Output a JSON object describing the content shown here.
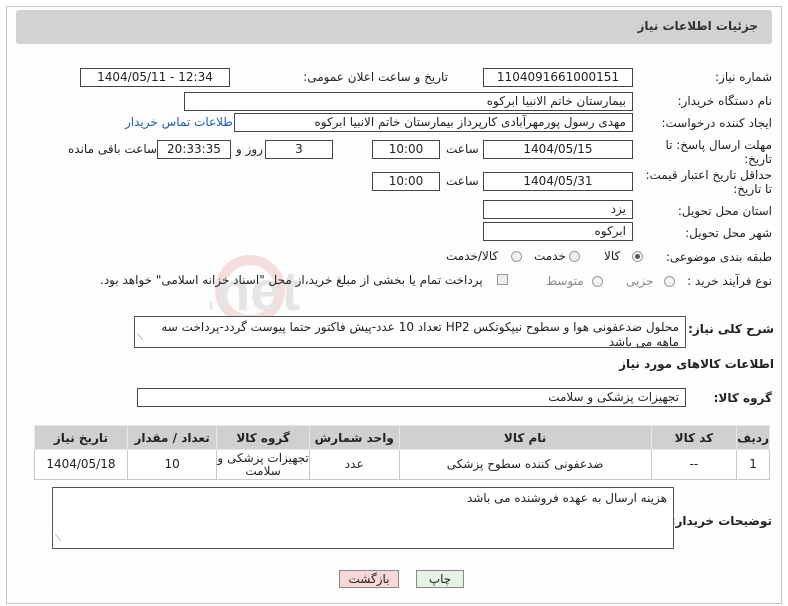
{
  "header": {
    "title": "جزئیات اطلاعات نیاز"
  },
  "fields": {
    "need_number_label": "شماره نیاز:",
    "need_number": "1104091661000151",
    "announce_label": "تاریخ و ساعت اعلان عمومی:",
    "announce_value": "1404/05/11 - 12:34",
    "buyer_org_label": "نام دستگاه خریدار:",
    "buyer_org": "بیمارستان خاتم الانبیا ابرکوه",
    "creator_label": "ایجاد کننده درخواست:",
    "creator": "مهدی رسول پورمهرآبادی کارپرداز بیمارستان خاتم الانبیا ابرکوه",
    "contact_link": "اطلاعات تماس خریدار",
    "deadline_label": "مهلت ارسال پاسخ: تا",
    "deadline_label2": "تاریخ:",
    "deadline_date": "1404/05/15",
    "time_label": "ساعت",
    "deadline_time": "10:00",
    "days_value": "3",
    "days_label": "روز و",
    "remaining_time": "20:33:35",
    "remaining_label": "ساعت باقی مانده",
    "validity_label": "حداقل تاریخ اعتبار قیمت:",
    "validity_label2": "تا تاریخ:",
    "validity_date": "1404/05/31",
    "validity_time": "10:00",
    "province_label": "استان محل تحویل:",
    "province": "یزد",
    "city_label": "شهر محل تحویل:",
    "city": "ابرکوه",
    "category_label": "طبقه بندی موضوعی:",
    "category_options": [
      "کالا",
      "خدمت",
      "کالا/خدمت"
    ],
    "process_label": "نوع فرآیند خرید :",
    "process_options": [
      "جزیی",
      "متوسط"
    ],
    "payment_note": "پرداخت تمام یا بخشی از مبلغ خرید،از محل \"اسناد خزانه اسلامی\" خواهد بود."
  },
  "description": {
    "label": "شرح کلی نیاز:",
    "text": "محلول ضدعفونی هوا و سطوح نیپکوتکس HP2 تعداد 10 عدد-پیش فاکتور حتما پیوست گردد-پرداخت سه ماهه می باشد"
  },
  "goods": {
    "section_title": "اطلاعات کالاهای مورد نیاز",
    "group_label": "گروه کالا:",
    "group_value": "تجهیزات پزشکی و سلامت",
    "columns": [
      "ردیف",
      "کد کالا",
      "نام کالا",
      "واحد شمارش",
      "گروه کالا",
      "تعداد / مقدار",
      "تاریخ نیاز"
    ],
    "rows": [
      [
        "1",
        "--",
        "ضدعفونی کننده سطوح پزشکی",
        "عدد",
        "تجهیزات پزشکی و سلامت",
        "10",
        "1404/05/18"
      ]
    ]
  },
  "buyer_notes": {
    "label": "توضیحات خریدار:",
    "text": "هزینه ارسال به عهده فروشنده می باشد"
  },
  "buttons": {
    "print": "چاپ",
    "back": "بازگشت"
  },
  "watermark": "AriaTender.net",
  "colors": {
    "header_bg": "#d2d2d2",
    "link": "#1a5fb4",
    "table_header": "#d0d0d0",
    "back_btn": "#f8d7d7",
    "print_btn": "#e4f3e4"
  }
}
